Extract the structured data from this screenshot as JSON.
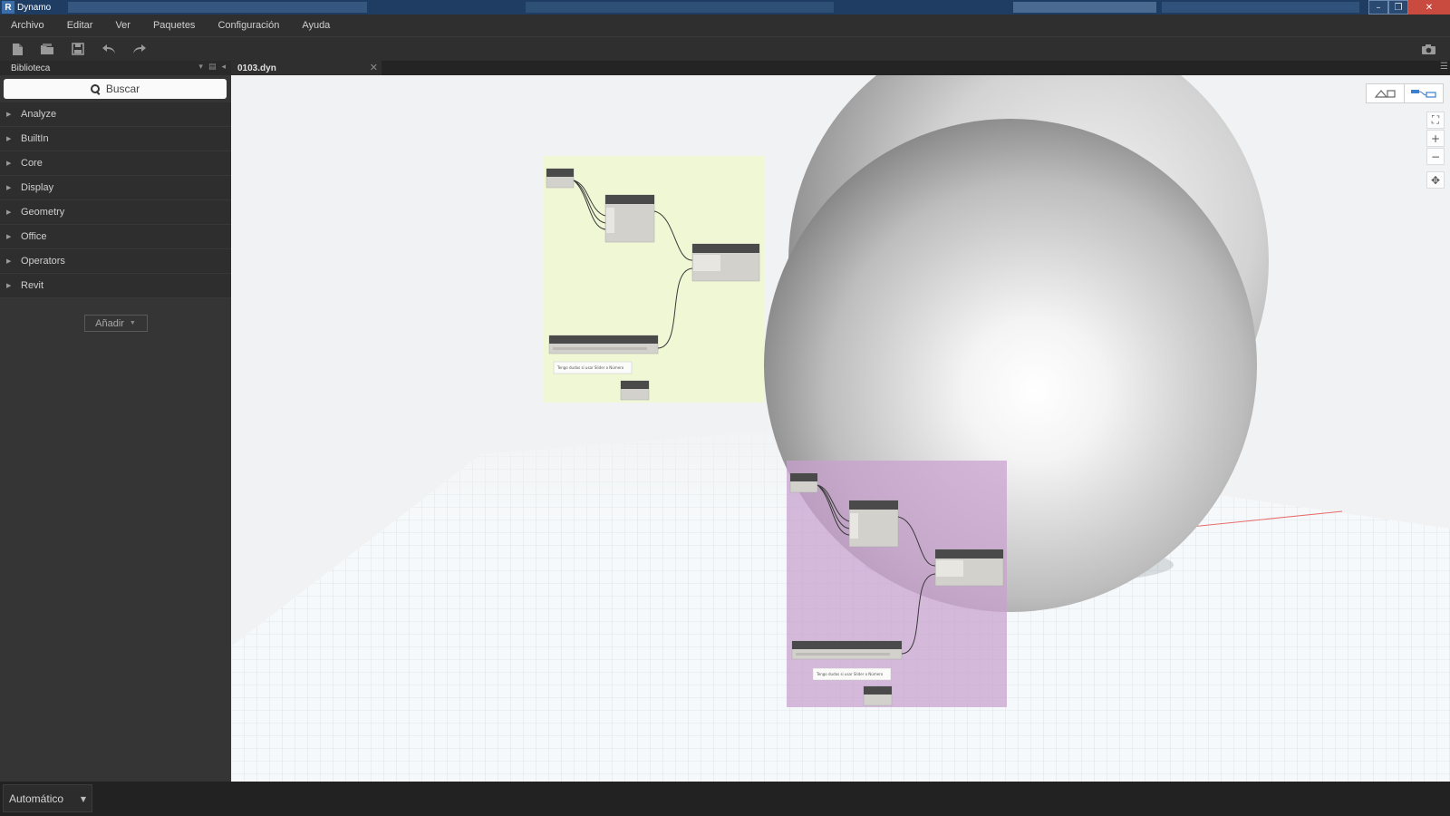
{
  "window": {
    "title": "Dynamo",
    "logo_letter": "R",
    "controls": {
      "minimize": "–",
      "restore": "❐",
      "close": "✕"
    }
  },
  "menu": {
    "items": [
      "Archivo",
      "Editar",
      "Ver",
      "Paquetes",
      "Configuración",
      "Ayuda"
    ]
  },
  "toolbar": {
    "icons": [
      "new-file-icon",
      "open-file-icon",
      "save-icon",
      "undo-icon",
      "redo-icon"
    ],
    "screenshot_icon": "camera-icon"
  },
  "library": {
    "title": "Biblioteca",
    "search_placeholder": "Buscar",
    "categories": [
      "Analyze",
      "BuiltIn",
      "Core",
      "Display",
      "Geometry",
      "Office",
      "Operators",
      "Revit"
    ],
    "add_label": "Añadir"
  },
  "tab": {
    "file_name": "0103.dyn",
    "close": "✕"
  },
  "canvas": {
    "view_toggle": {
      "geometry_icon": "geometry-view-icon",
      "graph_icon": "graph-view-icon"
    },
    "zoom": {
      "fit": "⛶",
      "zoom_in": "+",
      "zoom_out": "−",
      "pan": "✥"
    },
    "groups": [
      {
        "color": "#eff7d2",
        "note": "Tengo dudas si usar Slider o Número"
      },
      {
        "color": "#c7a0cf",
        "note": "Tengo dudas si usar Slider o Número"
      }
    ]
  },
  "status": {
    "run_mode": "Automático",
    "caret": "▼"
  }
}
